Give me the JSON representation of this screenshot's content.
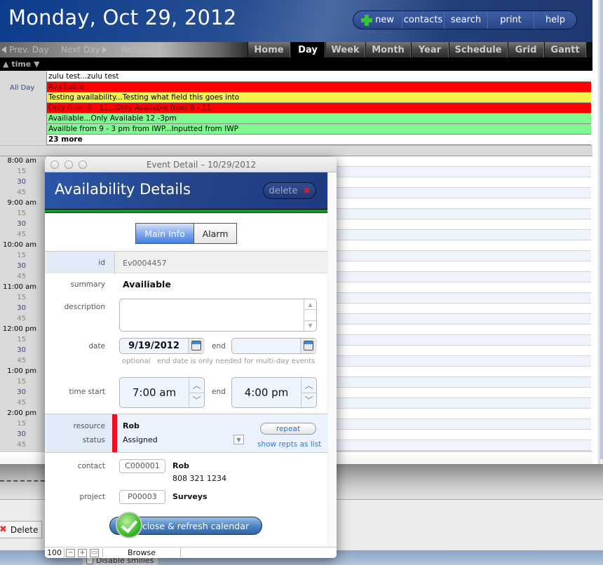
{
  "header": {
    "title": "Monday, Oct 29, 2012",
    "nav": [
      {
        "label": "new",
        "icon": "plus-icon"
      },
      {
        "label": "contacts"
      },
      {
        "label": "search"
      },
      {
        "label": "print"
      },
      {
        "label": "help"
      }
    ]
  },
  "toolbar": {
    "prev_day": "Prev. Day",
    "next_day": "Next Day",
    "refresh": "Refresh",
    "tabs": [
      "Home",
      "Day",
      "Week",
      "Month",
      "Year",
      "Schedule",
      "Grid",
      "Gantt"
    ],
    "active_tab": "Day"
  },
  "timebar": {
    "label": "time"
  },
  "allday": {
    "label": "All Day",
    "events": [
      {
        "text": "zulu test...zulu test",
        "color": "#ffffff",
        "text_color": "#000000"
      },
      {
        "text": "Availiable",
        "color": "#ff0000",
        "text_color": "#5a0000"
      },
      {
        "text": "Testing availability...Testing what field this goes into",
        "color": "#f5f04a",
        "text_color": "#000000"
      },
      {
        "text": "Only from 8 - 11...Only Available from 8 - 11",
        "color": "#ff0000",
        "text_color": "#5a0000"
      },
      {
        "text": "Availiable...Only Available 12 -3pm",
        "color": "#80fa90",
        "text_color": "#000000"
      },
      {
        "text": "Availble from 9 - 3 pm from IWP...Inputted from IWP",
        "color": "#80fa90",
        "text_color": "#000000"
      }
    ],
    "more": "23 more"
  },
  "times": [
    "8:00 am",
    "15",
    "30",
    "45",
    "9:00 am",
    "15",
    "30",
    "45",
    "10:00 am",
    "15",
    "30",
    "45",
    "11:00 am",
    "15",
    "30",
    "45",
    "12:00 pm",
    "15",
    "30",
    "45",
    "1:00 pm",
    "15",
    "30",
    "45",
    "2:00 pm",
    "15",
    "30",
    "45"
  ],
  "dialog": {
    "window_title": "Event Detail  –  10/29/2012",
    "heading": "Availability Details",
    "delete_label": "delete",
    "tabs": [
      "Main Info",
      "Alarm"
    ],
    "active_tab": "Main Info",
    "fields": {
      "id_label": "id",
      "id_value": "Ev0004457",
      "summary_label": "summary",
      "summary_value": "Availiable",
      "description_label": "description",
      "description_value": "",
      "date_label": "date",
      "date_value": "9/19/2012",
      "end_label": "end",
      "end_date_value": "",
      "optional_hint": "optional",
      "end_hint": "end date is only needed for multi-day events",
      "time_start_label": "time start",
      "time_start_value": "7:00 am",
      "time_end_label": "end",
      "time_end_value": "4:00 pm",
      "resource_label": "resource",
      "resource_value": "Rob",
      "status_label": "status",
      "status_value": "Assigned",
      "status_color": "#ee1122",
      "repeat_label": "repeat",
      "show_repts_label": "show repts as list",
      "contact_label": "contact",
      "contact_id": "C000001",
      "contact_name": "Rob",
      "contact_phone": "808 321 1234",
      "project_label": "project",
      "project_id": "P00003",
      "project_name": "Surveys"
    },
    "close_button": "close & refresh calendar",
    "statusbar": {
      "zoom": "100",
      "mode": "Browse"
    }
  },
  "background": {
    "delete_label": "Delete",
    "disable_smilies": "Disable smilies"
  }
}
